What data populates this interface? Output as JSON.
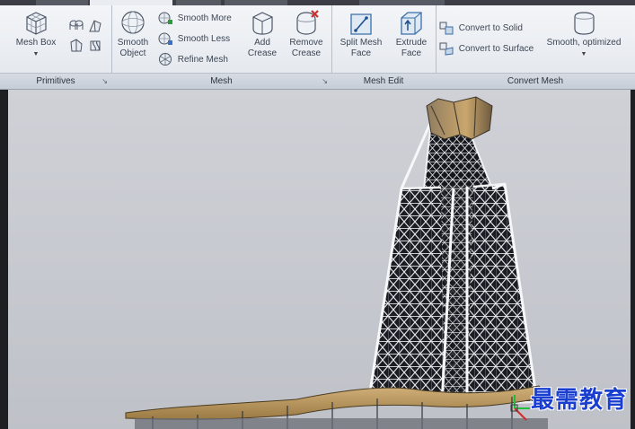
{
  "ribbon": {
    "panels": {
      "primitives": {
        "title": "Primitives",
        "mesh_box_label": "Mesh Box"
      },
      "mesh": {
        "title": "Mesh",
        "smooth_object_label": "Smooth Object",
        "smooth_more_label": "Smooth More",
        "smooth_less_label": "Smooth Less",
        "refine_mesh_label": "Refine Mesh",
        "add_crease_label": "Add Crease",
        "remove_crease_label": "Remove Crease"
      },
      "mesh_edit": {
        "title": "Mesh Edit",
        "split_mesh_face_label": "Split Mesh Face",
        "extrude_face_label": "Extrude Face"
      },
      "convert_mesh": {
        "title": "Convert Mesh",
        "convert_to_solid_label": "Convert to Solid",
        "convert_to_surface_label": "Convert to Surface",
        "smooth_optimized_label": "Smooth, optimized"
      }
    }
  },
  "watermark": "最需教育",
  "colors": {
    "accent_blue": "#1a3fd0",
    "tower_steel": "#e6e8ec",
    "tower_dark": "#16181d",
    "roof_gold": "#b8925a"
  }
}
